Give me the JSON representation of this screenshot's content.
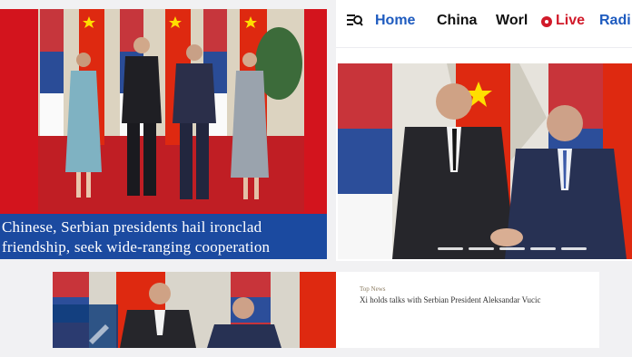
{
  "left_story": {
    "headline_line1": "Chinese, Serbian presidents hail ironclad",
    "headline_line2": "friendship, seek wide-ranging cooperation"
  },
  "nav": {
    "menu_icon": "menu-search-icon",
    "items": [
      "Home",
      "China",
      "Worl",
      "Live",
      "Radi"
    ],
    "live_icon": "record-dot-icon"
  },
  "bottom_story": {
    "tag": "Top News",
    "title": "Xi holds talks with Serbian President Aleksandar Vucic"
  },
  "colors": {
    "brand_red": "#d3141d",
    "headline_blue": "#1b4aa0",
    "nav_blue": "#1e5bbf",
    "live_red": "#d11a2a"
  }
}
